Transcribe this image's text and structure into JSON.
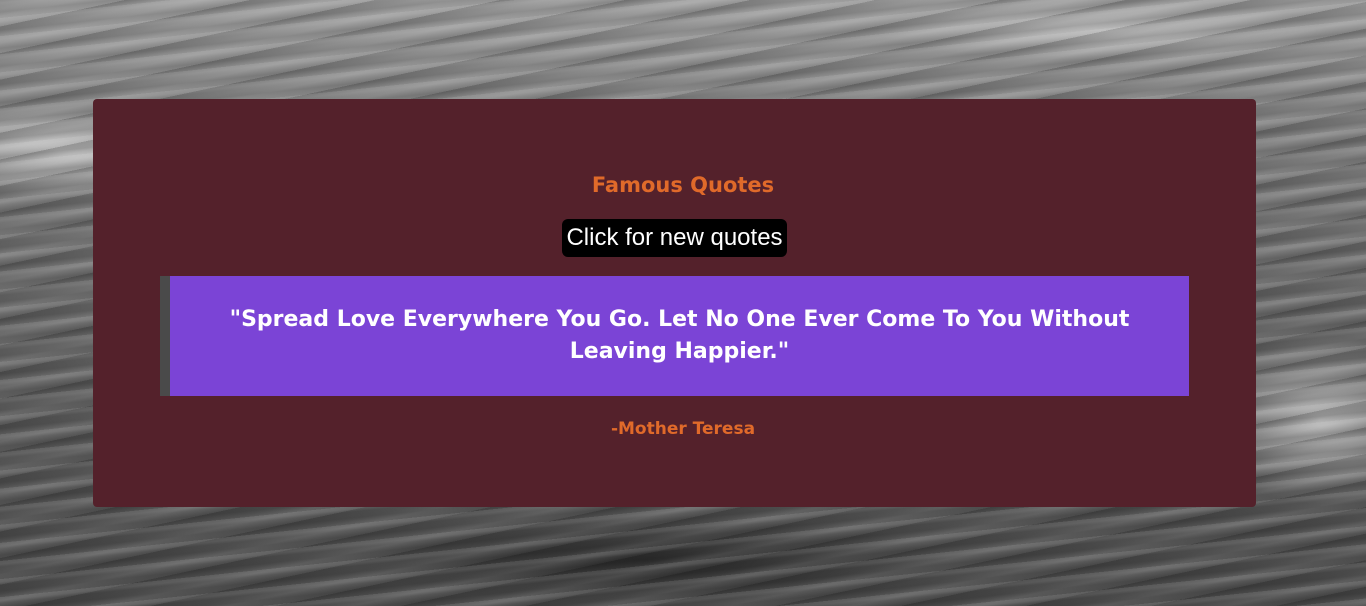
{
  "page": {
    "background": "ocean-waves-grayscale-image"
  },
  "card": {
    "title": "Famous Quotes",
    "button_label": "Click for new quotes",
    "quote": "\"Spread Love Everywhere You Go. Let No One Ever Come To You Without Leaving Happier.\"",
    "author": "-Mother Teresa"
  },
  "colors": {
    "card_background": "#54212b",
    "accent_text": "#e06a2a",
    "quote_background": "#7b44d6",
    "quote_border": "#4a4a4a",
    "button_background": "#000000",
    "button_text": "#ffffff"
  }
}
